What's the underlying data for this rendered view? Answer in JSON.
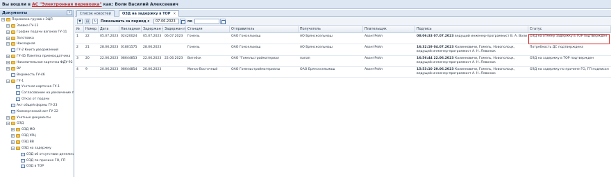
{
  "header": {
    "login_prefix": "Вы вошли в",
    "system_name": "АС \"Электронная перевозка\"",
    "login_suffix": "как: Воли Василий Алексеевич"
  },
  "sidebar": {
    "title": "Документы",
    "collapse_glyph": "«",
    "items": [
      {
        "label": "Перевозка грузов с ЭЦП"
      },
      {
        "label": "Заявка ГУ-12"
      },
      {
        "label": "График подачи вагонов ГУ-11"
      },
      {
        "label": "Заготовка"
      },
      {
        "label": "Накладная"
      },
      {
        "label": "ГУ-2 Книга уведомлений"
      },
      {
        "label": "ГУ-45 Памятка приемосдатчика"
      },
      {
        "label": "Накопительная карточка ФДУ-92"
      },
      {
        "label": "ВУ"
      },
      {
        "label": "Ведомость ГУ-46"
      },
      {
        "label": "ГУ-1"
      },
      {
        "label": "Учетная карточка ГУ-1"
      },
      {
        "label": "Согласование на увеличение п"
      },
      {
        "label": "Отказ от подачи"
      },
      {
        "label": "Акт общей формы ГУ-23"
      },
      {
        "label": "Коммерческий акт ГУ-22"
      },
      {
        "label": "Учетные документы"
      },
      {
        "label": "ОЗД"
      },
      {
        "label": "ОЗД МО"
      },
      {
        "label": "ОЗД УРЦ"
      },
      {
        "label": "ОЗД ВВ"
      },
      {
        "label": "ОЗД на задержку"
      },
      {
        "label": "ОЗД об отсутствии денежны"
      },
      {
        "label": "ОЗД по причине ГО, ГП"
      },
      {
        "label": "ОЗД в ТОР"
      }
    ]
  },
  "tabs": [
    {
      "label": "Список новостей"
    },
    {
      "label": "ОЗД на задержку в ТОР"
    }
  ],
  "toolbar": {
    "period_label": "Показывать за период с",
    "date_from": "07.06.2023",
    "to_label": "по",
    "date_to": ""
  },
  "table": {
    "columns": [
      "№",
      "Номер",
      "Дата",
      "Накладная",
      "Задержан с",
      "Задержан по",
      "Станция",
      "Отправитель",
      "Получатель",
      "Плательщик",
      "Подпись",
      "Статус"
    ],
    "rows": [
      {
        "n": "1",
        "num": "22",
        "date": "05.07.2023",
        "waybill": "02420024",
        "from": "05.07.2023",
        "to": "06.07.2023",
        "station": "Гомель",
        "sender": "ОАО Гомсельмаш",
        "receiver": "АО Брянсксельмаш",
        "payer": "АвантРейл",
        "sign_time": "08:06:33 07.07.2023",
        "sign_text": "ведущий инженер-программист В. А. Воли",
        "status": "ОЗД на отмену задержку в ТОР подтвержден"
      },
      {
        "n": "2",
        "num": "21",
        "date": "28.06.2023",
        "waybill": "01801575",
        "from": "28.06.2023",
        "to": "",
        "station": "Гомель",
        "sender": "ОАО Гомсельмаш",
        "receiver": "АО Брянсксельмаш",
        "payer": "АвантРейл",
        "sign_time": "16:32:19 04.07.2023",
        "sign_text": "Калинковичи, Гомель, Новополоцк, ведущий инженер-программист А. Н. Левонюк",
        "status": "Потребность ДС подтверждена"
      },
      {
        "n": "3",
        "num": "20",
        "date": "22.06.2023",
        "waybill": "08644853",
        "from": "22.06.2023",
        "to": "22.06.2023",
        "station": "Витебск",
        "sender": "ОАО \"Гомельстройматериал",
        "receiver": "папап",
        "payer": "АвантРейл",
        "sign_time": "16:56:44 22.06.2023",
        "sign_text": "Калинковичи, Гомель, Новополоцк, ведущий инженер-программист А. Н. Левонюк",
        "status": "ОЗД на задержку в ТОР подтвержден"
      },
      {
        "n": "4",
        "num": "9",
        "date": "20.06.2023",
        "waybill": "08644854",
        "from": "20.06.2023",
        "to": "",
        "station": "Минск-Восточный",
        "sender": "ОАО Гомельстройматериалы",
        "receiver": "ОАО Брянсксельмаш",
        "payer": "АвантРейл",
        "sign_time": "15:53:10 20.06.2023",
        "sign_text": "Калинковичи, Гомель, Новополоцк, ведущий инженер-программист А. Н. Левонюк",
        "status": "ОЗД на задержку по причине ГО, ГП подписан"
      }
    ]
  },
  "colors": {
    "highlight": "#d32020",
    "login_link": "#c62828",
    "header_bg": "#dde7f3"
  }
}
